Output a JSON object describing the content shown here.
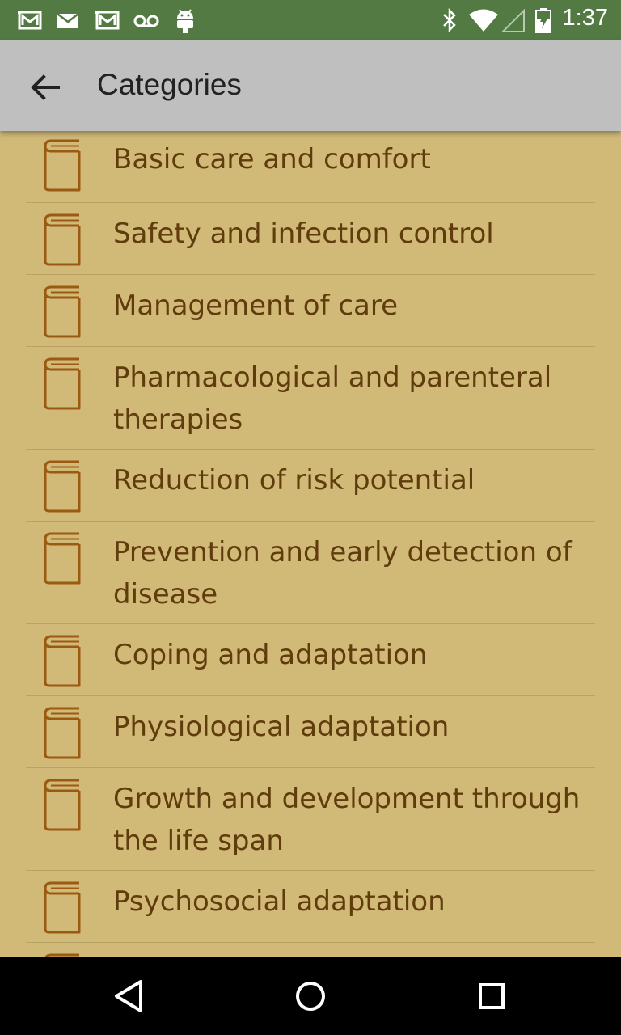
{
  "status_bar": {
    "time": "1:37",
    "icons": [
      "gmail-icon",
      "email-icon",
      "gmail-icon",
      "voicemail-icon",
      "android-icon",
      "bluetooth-icon",
      "wifi-icon",
      "signal-icon",
      "battery-charging-icon"
    ]
  },
  "app_bar": {
    "title": "Categories",
    "back_icon": "arrow-back-icon"
  },
  "categories": [
    {
      "label": "Basic care and comfort"
    },
    {
      "label": "Safety and infection control"
    },
    {
      "label": "Management of care"
    },
    {
      "label": "Pharmacological and parenteral therapies"
    },
    {
      "label": "Reduction of risk potential"
    },
    {
      "label": "Prevention and early detection of disease"
    },
    {
      "label": "Coping and adaptation"
    },
    {
      "label": "Physiological adaptation"
    },
    {
      "label": "Growth and development through the life span"
    },
    {
      "label": "Psychosocial adaptation"
    }
  ],
  "nav_bar": {
    "icons": [
      "back-triangle-icon",
      "home-circle-icon",
      "recents-square-icon"
    ]
  },
  "colors": {
    "status_bar": "#527a42",
    "app_bar": "#bfbfbf",
    "background": "#d1b978",
    "text": "#603c0c",
    "icon": "#9a5a10"
  }
}
